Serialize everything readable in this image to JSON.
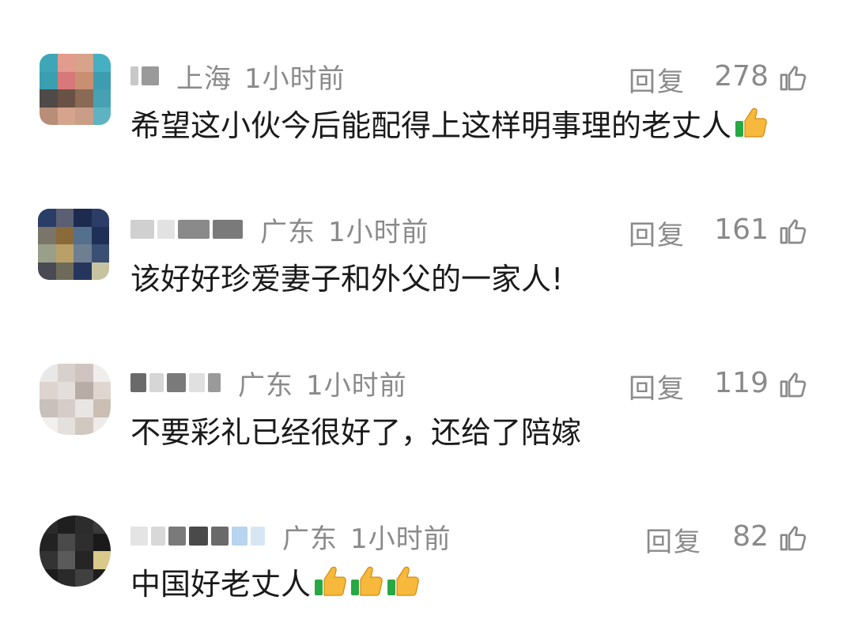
{
  "comments": [
    {
      "location": "上海",
      "time": "1小时前",
      "reply_label": "回复",
      "likes": "278",
      "text": "希望这小伙今后能配得上这样明事理的老丈人",
      "emoji": "thumbs-up-icon",
      "emoji_count": 1
    },
    {
      "location": "广东",
      "time": "1小时前",
      "reply_label": "回复",
      "likes": "161",
      "text": "该好好珍爱妻子和外父的一家人!",
      "emoji_count": 0
    },
    {
      "location": "广东",
      "time": "1小时前",
      "reply_label": "回复",
      "likes": "119",
      "text": "不要彩礼已经很好了，还给了陪嫁",
      "emoji_count": 0
    },
    {
      "location": "广东",
      "time": "1小时前",
      "reply_label": "回复",
      "likes": "82",
      "text": "中国好老丈人",
      "emoji": "thumbs-up-icon",
      "emoji_count": 3
    }
  ],
  "colors": {
    "meta_gray": "#8a8a8a",
    "text_dark": "#1a1a1a",
    "thumb_yellow": "#f6b93b",
    "thumb_green": "#27a844"
  }
}
